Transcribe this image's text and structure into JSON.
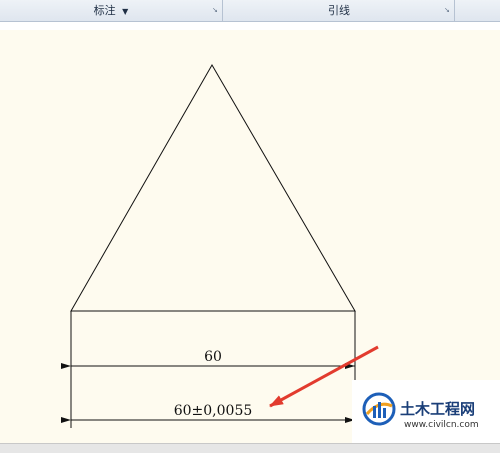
{
  "ribbon": {
    "panels": [
      {
        "label": "标注",
        "has_dropdown": true
      },
      {
        "label": "引线",
        "has_dropdown": false
      }
    ],
    "dropdown_glyph": "▼",
    "launcher_glyph": "↘"
  },
  "drawing": {
    "dimensions": [
      {
        "text": "60"
      },
      {
        "text": "60±0,0055"
      }
    ],
    "annotation_arrow_color": "#e23b2e",
    "background_color": "#fefbef"
  },
  "watermark": {
    "title": "土木工程网",
    "url": "www.civilcn.com"
  }
}
